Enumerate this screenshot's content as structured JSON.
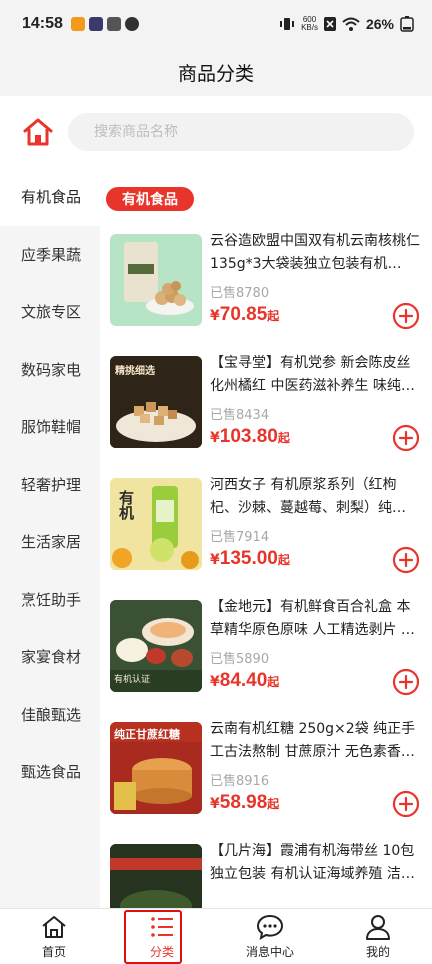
{
  "status": {
    "time": "14:58",
    "net_speed_value": "600",
    "net_speed_unit": "KB/s",
    "battery": "26%"
  },
  "header": {
    "title": "商品分类"
  },
  "search": {
    "placeholder": "搜索商品名称"
  },
  "sidebar": {
    "items": [
      {
        "label": "有机食品"
      },
      {
        "label": "应季果蔬"
      },
      {
        "label": "文旅专区"
      },
      {
        "label": "数码家电"
      },
      {
        "label": "服饰鞋帽"
      },
      {
        "label": "轻奢护理"
      },
      {
        "label": "生活家居"
      },
      {
        "label": "烹饪助手"
      },
      {
        "label": "家宴食材"
      },
      {
        "label": "佳酿甄选"
      },
      {
        "label": "甄选食品"
      }
    ]
  },
  "category": {
    "pill": "有机食品"
  },
  "products": [
    {
      "name": "云谷造欧盟中国双有机云南核桃仁135g*3大袋装独立包装有机…",
      "sold": "已售8780",
      "yen": "¥",
      "price": "70.85",
      "suffix": "起"
    },
    {
      "name": "【宝寻堂】有机党参 新会陈皮丝化州橘红 中医药滋补养生 味纯…",
      "sold": "已售8434",
      "yen": "¥",
      "price": "103.80",
      "suffix": "起",
      "img_text": "精挑细选"
    },
    {
      "name": "河西女子 有机原浆系列（红枸杞、沙棘、蔓越莓、刺梨）纯…",
      "sold": "已售7914",
      "yen": "¥",
      "price": "135.00",
      "suffix": "起",
      "img_text": "有机"
    },
    {
      "name": "【金地元】有机鲜食百合礼盒 本草精华原色原味 人工精选剥片 …",
      "sold": "已售5890",
      "yen": "¥",
      "price": "84.40",
      "suffix": "起",
      "img_text": "有机认证"
    },
    {
      "name": "云南有机红糖 250g×2袋 纯正手工古法熬制 甘蔗原汁 无色素香…",
      "sold": "已售8916",
      "yen": "¥",
      "price": "58.98",
      "suffix": "起",
      "img_text": "纯正甘蔗红糖"
    },
    {
      "name": "【几片海】霞浦有机海带丝 10包独立包装 有机认证海域养殖 洁…",
      "sold": "",
      "yen": "",
      "price": "",
      "suffix": ""
    }
  ],
  "tabs": [
    {
      "label": "首页"
    },
    {
      "label": "分类"
    },
    {
      "label": "消息中心"
    },
    {
      "label": "我的"
    }
  ],
  "colors": {
    "accent": "#e8352b",
    "sidebar_bg": "#f5f5f5"
  }
}
